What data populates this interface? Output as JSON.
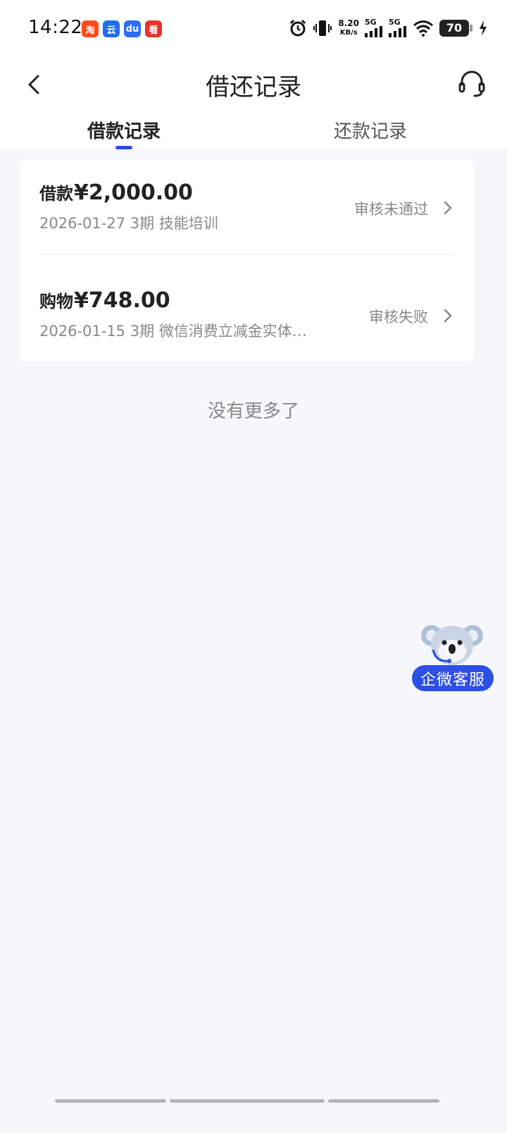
{
  "status_bar": {
    "time": "14:22",
    "apps": [
      {
        "icon": "taobao-icon",
        "label": "淘",
        "color": "#ff4a1c"
      },
      {
        "icon": "koala-app-icon",
        "label": "云",
        "color": "#1e6ef0"
      },
      {
        "icon": "baidu-icon",
        "label": "du",
        "color": "#2f6cf0"
      },
      {
        "icon": "red-app-icon",
        "label": "看",
        "color": "#e8332a"
      }
    ],
    "net_speed_value": "8.20",
    "net_speed_unit": "KB/s",
    "signal1_label": "5G",
    "signal2_label": "5G",
    "battery": "70"
  },
  "header": {
    "title": "借还记录",
    "tabs": [
      {
        "label": "借款记录",
        "active": true
      },
      {
        "label": "还款记录",
        "active": false
      }
    ]
  },
  "records": [
    {
      "type_label": "借款",
      "amount": "¥2,000.00",
      "subtitle": "2026-01-27 3期  技能培训",
      "status": "审核未通过"
    },
    {
      "type_label": "购物",
      "amount": "¥748.00",
      "subtitle": "2026-01-15 3期  微信消费立减金实体…",
      "status": "审核失败"
    }
  ],
  "footer_text": "没有更多了",
  "float_service": {
    "label": "企微客服"
  },
  "colors": {
    "accent": "#2d4ce0",
    "background": "#f6f7fb",
    "muted_text": "#888888"
  }
}
